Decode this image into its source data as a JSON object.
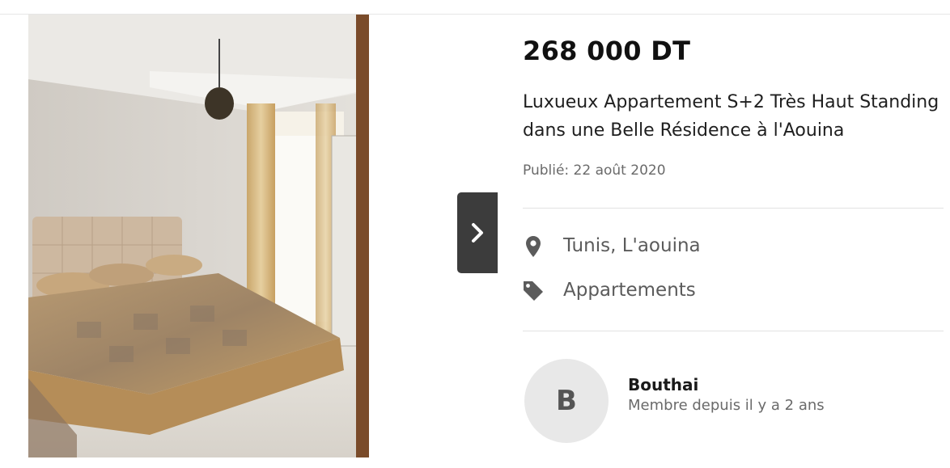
{
  "listing": {
    "price": "268 000 DT",
    "title": "Luxueux Appartement S+2 Très Haut Standing dans une Belle Résidence à l'Aouina",
    "published": "Publié: 22 août 2020",
    "location": "Tunis, L'aouina",
    "category": "Appartements"
  },
  "seller": {
    "initial": "B",
    "name": "Bouthai",
    "member_since": "Membre depuis il y a 2 ans"
  },
  "icons": {
    "location": "map-marker-icon",
    "category": "tag-icon",
    "next": "chevron-right-icon"
  },
  "colors": {
    "nav_button": "#3c3c3c",
    "avatar_bg": "#e8e8e8"
  }
}
